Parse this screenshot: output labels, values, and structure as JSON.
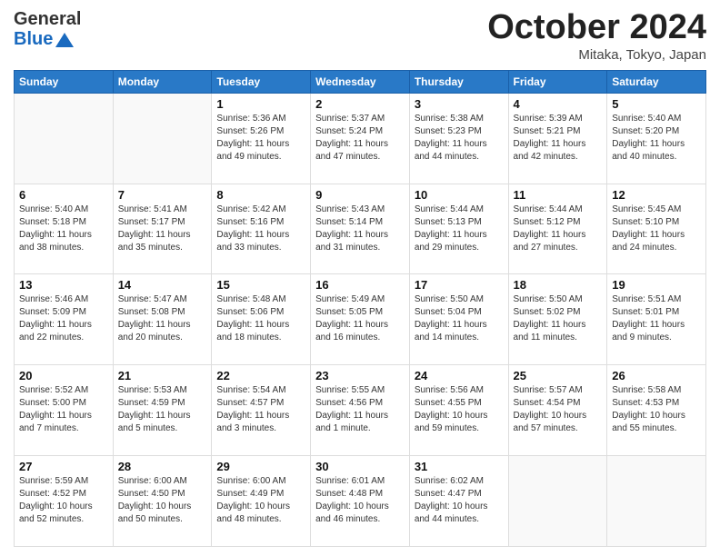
{
  "header": {
    "logo_line1": "General",
    "logo_line2": "Blue",
    "month_title": "October 2024",
    "location": "Mitaka, Tokyo, Japan"
  },
  "weekdays": [
    "Sunday",
    "Monday",
    "Tuesday",
    "Wednesday",
    "Thursday",
    "Friday",
    "Saturday"
  ],
  "weeks": [
    [
      {
        "day": "",
        "info": ""
      },
      {
        "day": "",
        "info": ""
      },
      {
        "day": "1",
        "info": "Sunrise: 5:36 AM\nSunset: 5:26 PM\nDaylight: 11 hours and 49 minutes."
      },
      {
        "day": "2",
        "info": "Sunrise: 5:37 AM\nSunset: 5:24 PM\nDaylight: 11 hours and 47 minutes."
      },
      {
        "day": "3",
        "info": "Sunrise: 5:38 AM\nSunset: 5:23 PM\nDaylight: 11 hours and 44 minutes."
      },
      {
        "day": "4",
        "info": "Sunrise: 5:39 AM\nSunset: 5:21 PM\nDaylight: 11 hours and 42 minutes."
      },
      {
        "day": "5",
        "info": "Sunrise: 5:40 AM\nSunset: 5:20 PM\nDaylight: 11 hours and 40 minutes."
      }
    ],
    [
      {
        "day": "6",
        "info": "Sunrise: 5:40 AM\nSunset: 5:18 PM\nDaylight: 11 hours and 38 minutes."
      },
      {
        "day": "7",
        "info": "Sunrise: 5:41 AM\nSunset: 5:17 PM\nDaylight: 11 hours and 35 minutes."
      },
      {
        "day": "8",
        "info": "Sunrise: 5:42 AM\nSunset: 5:16 PM\nDaylight: 11 hours and 33 minutes."
      },
      {
        "day": "9",
        "info": "Sunrise: 5:43 AM\nSunset: 5:14 PM\nDaylight: 11 hours and 31 minutes."
      },
      {
        "day": "10",
        "info": "Sunrise: 5:44 AM\nSunset: 5:13 PM\nDaylight: 11 hours and 29 minutes."
      },
      {
        "day": "11",
        "info": "Sunrise: 5:44 AM\nSunset: 5:12 PM\nDaylight: 11 hours and 27 minutes."
      },
      {
        "day": "12",
        "info": "Sunrise: 5:45 AM\nSunset: 5:10 PM\nDaylight: 11 hours and 24 minutes."
      }
    ],
    [
      {
        "day": "13",
        "info": "Sunrise: 5:46 AM\nSunset: 5:09 PM\nDaylight: 11 hours and 22 minutes."
      },
      {
        "day": "14",
        "info": "Sunrise: 5:47 AM\nSunset: 5:08 PM\nDaylight: 11 hours and 20 minutes."
      },
      {
        "day": "15",
        "info": "Sunrise: 5:48 AM\nSunset: 5:06 PM\nDaylight: 11 hours and 18 minutes."
      },
      {
        "day": "16",
        "info": "Sunrise: 5:49 AM\nSunset: 5:05 PM\nDaylight: 11 hours and 16 minutes."
      },
      {
        "day": "17",
        "info": "Sunrise: 5:50 AM\nSunset: 5:04 PM\nDaylight: 11 hours and 14 minutes."
      },
      {
        "day": "18",
        "info": "Sunrise: 5:50 AM\nSunset: 5:02 PM\nDaylight: 11 hours and 11 minutes."
      },
      {
        "day": "19",
        "info": "Sunrise: 5:51 AM\nSunset: 5:01 PM\nDaylight: 11 hours and 9 minutes."
      }
    ],
    [
      {
        "day": "20",
        "info": "Sunrise: 5:52 AM\nSunset: 5:00 PM\nDaylight: 11 hours and 7 minutes."
      },
      {
        "day": "21",
        "info": "Sunrise: 5:53 AM\nSunset: 4:59 PM\nDaylight: 11 hours and 5 minutes."
      },
      {
        "day": "22",
        "info": "Sunrise: 5:54 AM\nSunset: 4:57 PM\nDaylight: 11 hours and 3 minutes."
      },
      {
        "day": "23",
        "info": "Sunrise: 5:55 AM\nSunset: 4:56 PM\nDaylight: 11 hours and 1 minute."
      },
      {
        "day": "24",
        "info": "Sunrise: 5:56 AM\nSunset: 4:55 PM\nDaylight: 10 hours and 59 minutes."
      },
      {
        "day": "25",
        "info": "Sunrise: 5:57 AM\nSunset: 4:54 PM\nDaylight: 10 hours and 57 minutes."
      },
      {
        "day": "26",
        "info": "Sunrise: 5:58 AM\nSunset: 4:53 PM\nDaylight: 10 hours and 55 minutes."
      }
    ],
    [
      {
        "day": "27",
        "info": "Sunrise: 5:59 AM\nSunset: 4:52 PM\nDaylight: 10 hours and 52 minutes."
      },
      {
        "day": "28",
        "info": "Sunrise: 6:00 AM\nSunset: 4:50 PM\nDaylight: 10 hours and 50 minutes."
      },
      {
        "day": "29",
        "info": "Sunrise: 6:00 AM\nSunset: 4:49 PM\nDaylight: 10 hours and 48 minutes."
      },
      {
        "day": "30",
        "info": "Sunrise: 6:01 AM\nSunset: 4:48 PM\nDaylight: 10 hours and 46 minutes."
      },
      {
        "day": "31",
        "info": "Sunrise: 6:02 AM\nSunset: 4:47 PM\nDaylight: 10 hours and 44 minutes."
      },
      {
        "day": "",
        "info": ""
      },
      {
        "day": "",
        "info": ""
      }
    ]
  ]
}
